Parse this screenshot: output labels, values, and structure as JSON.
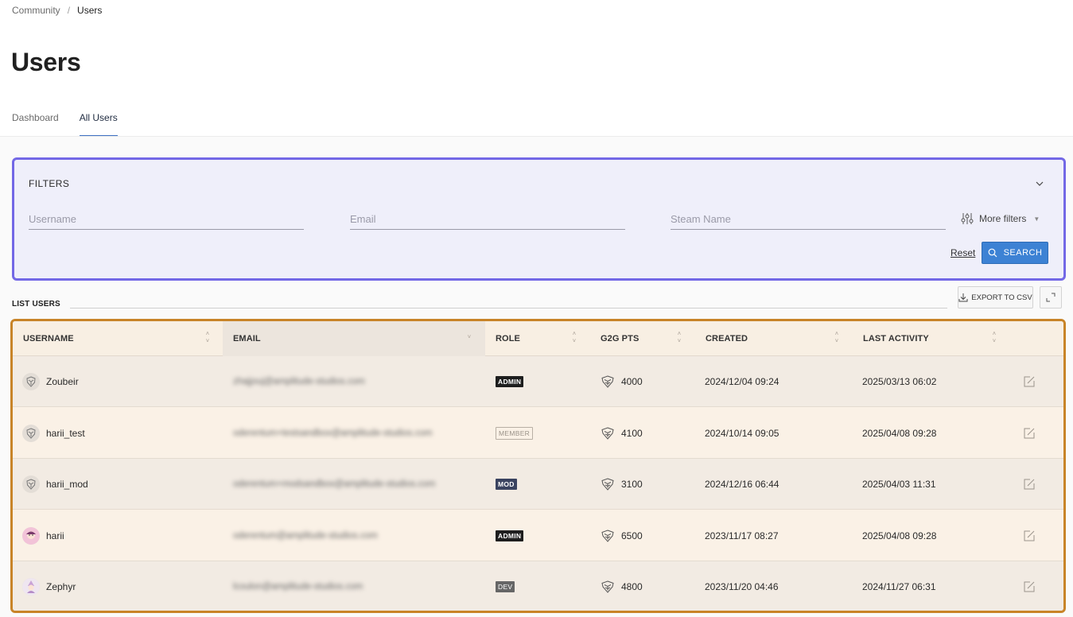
{
  "breadcrumb": {
    "parent": "Community",
    "separator": "/",
    "current": "Users"
  },
  "page_title": "Users",
  "tabs": [
    {
      "label": "Dashboard",
      "active": false
    },
    {
      "label": "All Users",
      "active": true
    }
  ],
  "filters": {
    "title": "FILTERS",
    "username_placeholder": "Username",
    "email_placeholder": "Email",
    "steam_placeholder": "Steam Name",
    "more_filters": "More filters",
    "reset": "Reset",
    "search": "SEARCH"
  },
  "list": {
    "title": "LIST USERS",
    "export": "EXPORT TO CSV"
  },
  "table": {
    "columns": [
      {
        "label": "USERNAME"
      },
      {
        "label": "EMAIL"
      },
      {
        "label": "ROLE"
      },
      {
        "label": "G2G PTS"
      },
      {
        "label": "CREATED"
      },
      {
        "label": "LAST ACTIVITY"
      }
    ],
    "rows": [
      {
        "username": "Zoubeir",
        "avatar": "default-avatar-icon",
        "email": "zhajjouj@amplitude-studios.com",
        "role": "ADMIN",
        "role_style": "admin",
        "pts": "4000",
        "created": "2024/12/04 09:24",
        "last_activity": "2025/03/13 06:02"
      },
      {
        "username": "harii_test",
        "avatar": "default-avatar-icon",
        "email": "oderentum+testsandbox@amplitude-studios.com",
        "role": "MEMBER",
        "role_style": "member",
        "pts": "4100",
        "created": "2024/10/14 09:05",
        "last_activity": "2025/04/08 09:28"
      },
      {
        "username": "harii_mod",
        "avatar": "default-avatar-icon",
        "email": "oderentum+modsandbox@amplitude-studios.com",
        "role": "MOD",
        "role_style": "mod",
        "pts": "3100",
        "created": "2024/12/16 06:44",
        "last_activity": "2025/04/03 11:31"
      },
      {
        "username": "harii",
        "avatar": "pink-character-avatar-icon",
        "email": "oderentum@amplitude-studios.com",
        "role": "ADMIN",
        "role_style": "admin",
        "pts": "6500",
        "created": "2023/11/17 08:27",
        "last_activity": "2025/04/08 09:28"
      },
      {
        "username": "Zephyr",
        "avatar": "character-avatar-icon",
        "email": "lcoulon@amplitude-studios.com",
        "role": "DEV",
        "role_style": "dev",
        "pts": "4800",
        "created": "2023/11/20 04:46",
        "last_activity": "2024/11/27 06:31"
      }
    ]
  },
  "colors": {
    "accent_blue": "#3d82d4",
    "filters_highlight": "#7368e6",
    "table_highlight": "#c88428"
  }
}
